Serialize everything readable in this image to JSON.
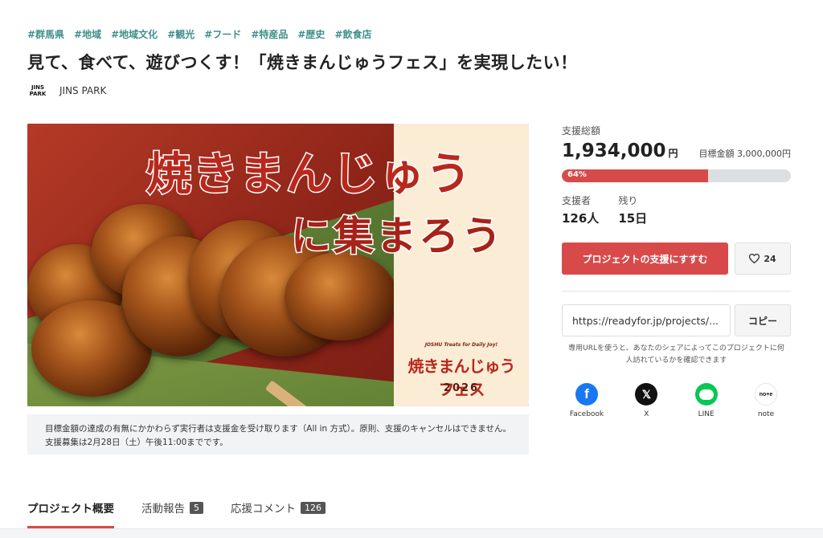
{
  "tags": [
    "#群馬県",
    "#地域",
    "#地域文化",
    "#観光",
    "#フード",
    "#特産品",
    "#歴史",
    "#飲食店"
  ],
  "title": "見て、食べて、遊びつくす！「焼きまんじゅうフェス」を実現したい！",
  "owner": {
    "logo_line1": "JINS",
    "logo_line2": "PARK",
    "name": "JINS PARK"
  },
  "hero": {
    "headline1": "焼きまんじゅう",
    "headline2": "に集まろう",
    "logo_sub": "JOSHU Treats for Daily Joy!",
    "logo": "焼きまんじゅうフェス",
    "year": "2026"
  },
  "notice": "目標金額の達成の有無にかかわらず実行者は支援金を受け取ります（All in 方式）。原則、支援のキャンセルはできません。支援募集は2月28日（土）午後11:00までです。",
  "funding": {
    "total_label": "支援総額",
    "amount": "1,934,000",
    "currency": "円",
    "goal_label": "目標金額",
    "goal_amount": "3,000,000円",
    "progress_text": "64%",
    "progress_fraction": 0.64,
    "supporters_label": "支援者",
    "supporters_value": "126人",
    "remaining_label": "残り",
    "remaining_value": "15日"
  },
  "actions": {
    "support_label": "プロジェクトの支援にすすむ",
    "like_count": "24"
  },
  "share": {
    "url": "https://readyfor.jp/projects/...",
    "copy_label": "コピー",
    "help_text": "専用URLを使うと、あなたのシェアによってこのプロジェクトに何人訪れているかを確認できます",
    "items": [
      {
        "label": "Facebook",
        "icon": "facebook-icon",
        "color": "#1877f2"
      },
      {
        "label": "X",
        "icon": "x-icon",
        "color": "#111111"
      },
      {
        "label": "LINE",
        "icon": "line-icon",
        "color": "#06c755"
      },
      {
        "label": "note",
        "icon": "note-icon",
        "color": "#ffffff"
      }
    ]
  },
  "tabs": [
    {
      "label": "プロジェクト概要",
      "count": ""
    },
    {
      "label": "活動報告",
      "count": "5"
    },
    {
      "label": "応援コメント",
      "count": "126"
    }
  ],
  "colors": {
    "accent": "#d84a4a",
    "tag": "#3f8f8c"
  }
}
